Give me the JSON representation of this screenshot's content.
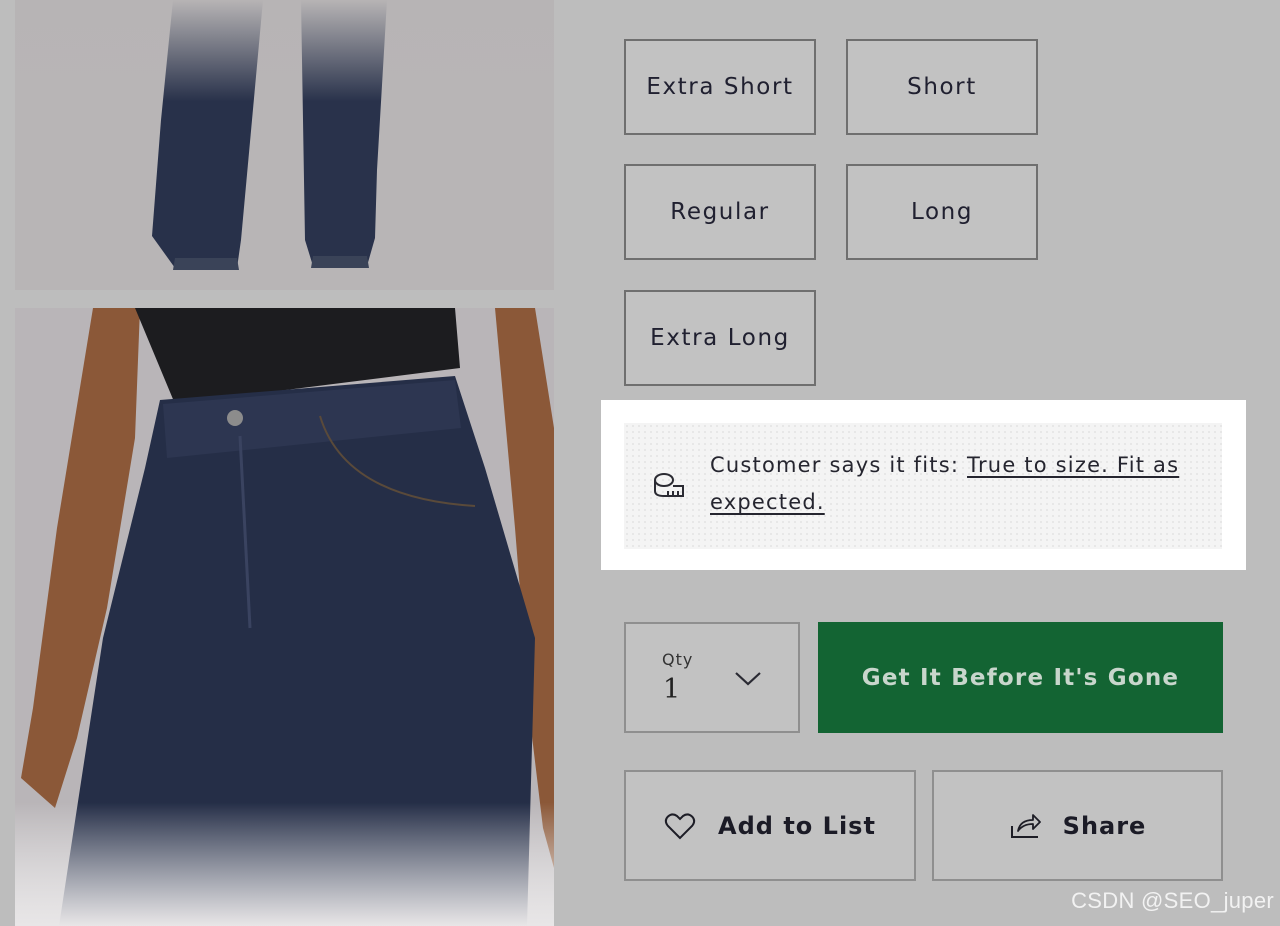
{
  "colors": {
    "page_bg": "#bdbdbd",
    "cta_bg": "#136433",
    "fit_highlight": "#ffffff",
    "denim": "#26304a"
  },
  "gallery": {
    "images": [
      {
        "name": "jeans-legs-photo"
      },
      {
        "name": "jeans-waist-photo"
      }
    ]
  },
  "length_options": [
    {
      "label": "Extra Short"
    },
    {
      "label": "Short"
    },
    {
      "label": "Regular"
    },
    {
      "label": "Long"
    },
    {
      "label": "Extra Long"
    }
  ],
  "fit": {
    "icon": "measuring-tape-icon",
    "prefix": "Customer says it fits: ",
    "link": "True to size. Fit as expected."
  },
  "qty": {
    "label": "Qty",
    "value": "1",
    "icon": "chevron-down-icon"
  },
  "cta": {
    "label": "Get It Before It's Gone"
  },
  "actions": {
    "add_to_list": {
      "label": "Add to List",
      "icon": "heart-icon"
    },
    "share": {
      "label": "Share",
      "icon": "share-icon"
    }
  },
  "watermark": "CSDN @SEO_juper"
}
